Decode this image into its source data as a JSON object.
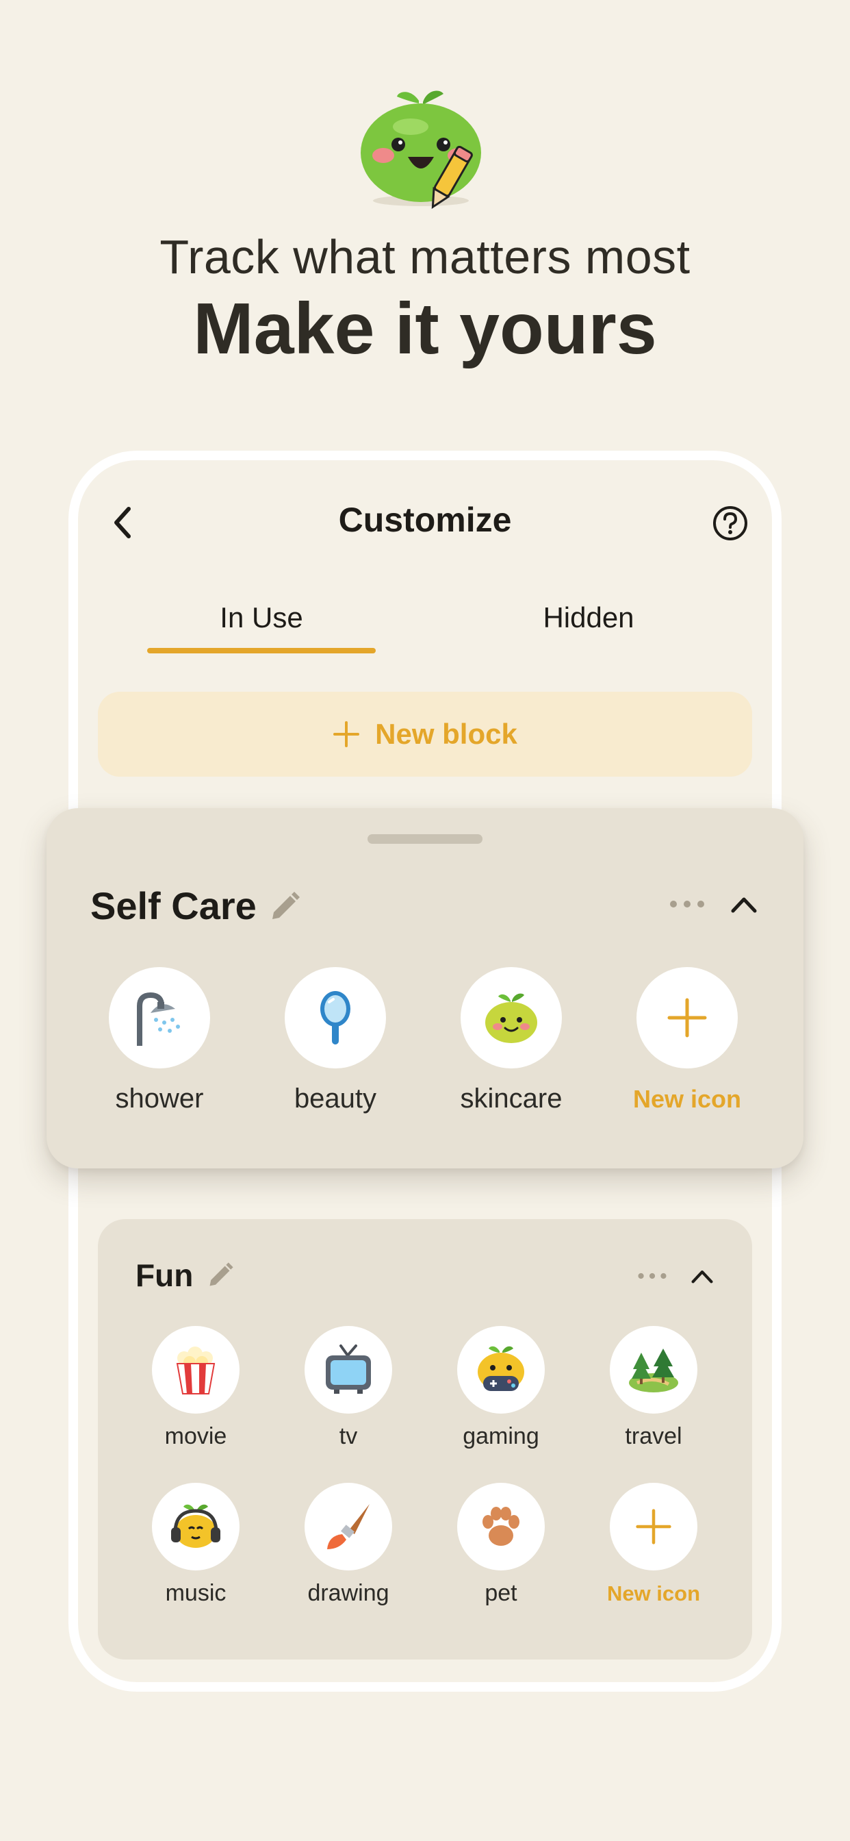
{
  "header": {
    "subtitle": "Track what matters most",
    "title": "Make it yours",
    "mascot_icon": "green-blob-with-pencil-icon"
  },
  "screen": {
    "title": "Customize",
    "back_icon": "chevron-left-icon",
    "help_icon": "help-circle-icon"
  },
  "tabs": [
    {
      "label": "In Use",
      "active": true
    },
    {
      "label": "Hidden",
      "active": false
    }
  ],
  "new_block": {
    "label": "New block",
    "icon": "plus-icon"
  },
  "blocks": [
    {
      "title": "Self Care",
      "items": [
        {
          "label": "shower",
          "icon": "shower-icon"
        },
        {
          "label": "beauty",
          "icon": "mirror-icon"
        },
        {
          "label": "skincare",
          "icon": "sprout-face-icon"
        },
        {
          "label": "New icon",
          "icon": "plus-icon"
        }
      ]
    },
    {
      "title": "Fun",
      "items": [
        {
          "label": "movie",
          "icon": "popcorn-icon"
        },
        {
          "label": "tv",
          "icon": "tv-icon"
        },
        {
          "label": "gaming",
          "icon": "gamepad-icon"
        },
        {
          "label": "travel",
          "icon": "landscape-icon"
        },
        {
          "label": "music",
          "icon": "headphones-icon"
        },
        {
          "label": "drawing",
          "icon": "paintbrush-icon"
        },
        {
          "label": "pet",
          "icon": "paw-icon"
        },
        {
          "label": "New icon",
          "icon": "plus-icon"
        }
      ]
    }
  ],
  "colors": {
    "background": "#f5f1e7",
    "accent": "#e4a62a",
    "card": "#e7e1d4",
    "new_block_bg": "#f8ebcf",
    "text": "#1e1c18"
  }
}
